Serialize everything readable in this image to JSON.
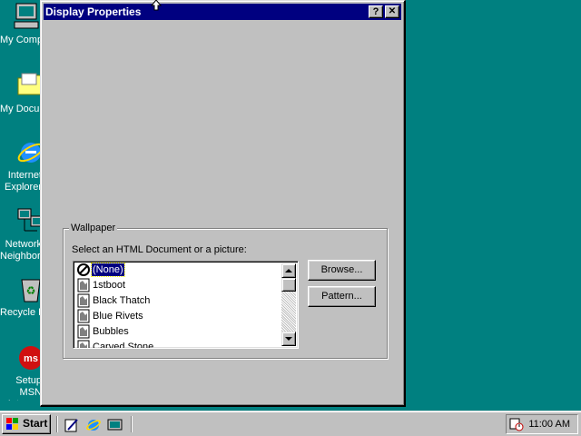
{
  "desktop": {
    "icons": [
      {
        "label": "My Computer"
      },
      {
        "label": "My Documents"
      },
      {
        "label": "Internet Explorer"
      },
      {
        "label": "Network Neighborhood"
      },
      {
        "label": "Recycle Bin"
      },
      {
        "label": "Setup MSN Internet Access"
      }
    ]
  },
  "window": {
    "title": "Display Properties",
    "help_button": "?",
    "close_button": "✕"
  },
  "wallpaper": {
    "group_label": "Wallpaper",
    "prompt": "Select an HTML Document or a picture:",
    "items": [
      {
        "label": "(None)",
        "icon": "none-icon",
        "selected": true
      },
      {
        "label": "1stboot",
        "icon": "bitmap-file-icon"
      },
      {
        "label": "Black Thatch",
        "icon": "bitmap-file-icon"
      },
      {
        "label": "Blue Rivets",
        "icon": "bitmap-file-icon"
      },
      {
        "label": "Bubbles",
        "icon": "bitmap-file-icon"
      },
      {
        "label": "Carved Stone",
        "icon": "bitmap-file-icon"
      }
    ],
    "browse_label": "Browse...",
    "pattern_label": "Pattern..."
  },
  "taskbar": {
    "start_label": "Start",
    "clock": "11:00 AM"
  },
  "colors": {
    "desktop": "#008080",
    "titlebar": "#000080",
    "face": "#c0c0c0"
  }
}
